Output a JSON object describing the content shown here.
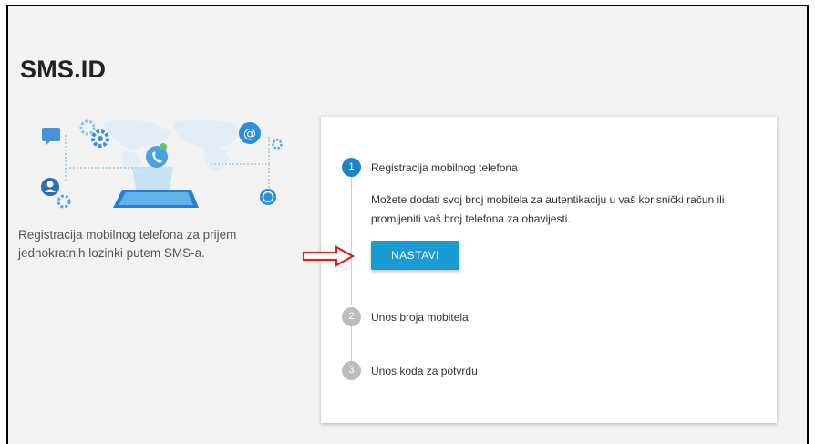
{
  "header": {
    "title": "SMS.ID"
  },
  "intro": {
    "line1": "Registracija mobilnog telefona za prijem",
    "line2": "jednokratnih lozinki putem SMS-a."
  },
  "steps": [
    {
      "number": "1",
      "label": "Registracija mobilnog telefona",
      "desc_line1": "Možete dodati svoj broj mobitela za autentikaciju u vaš korisnički račun ili",
      "desc_line2": "promijeniti vaš broj telefona za obavijesti.",
      "button_label": "NASTAVI"
    },
    {
      "number": "2",
      "label": "Unos broja mobitela"
    },
    {
      "number": "3",
      "label": "Unos koda za potvrdu"
    }
  ],
  "colors": {
    "active_step": "#1f84c6",
    "inactive_step": "#bdbdbd",
    "button": "#1a9bd3",
    "annotation_arrow": "#d9261c"
  }
}
